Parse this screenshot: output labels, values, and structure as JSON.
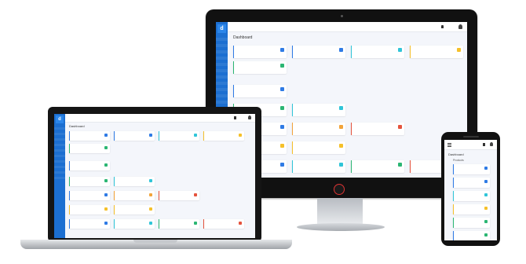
{
  "dashboard_title": "Dashboard",
  "phone_section": "Products",
  "colors": {
    "sidebar": "#1c6fd1",
    "blue": "#2f7be5",
    "green": "#2bb673",
    "cyan": "#30c5d8",
    "yellow": "#f5c02a",
    "red": "#e5533d",
    "orange": "#f2a43a"
  },
  "icons": [
    "user-icon",
    "bell-icon",
    "file-icon",
    "thumbs-up-icon",
    "chat-icon",
    "folder-icon",
    "inbox-icon",
    "gift-icon",
    "cart-icon",
    "flag-icon"
  ]
}
